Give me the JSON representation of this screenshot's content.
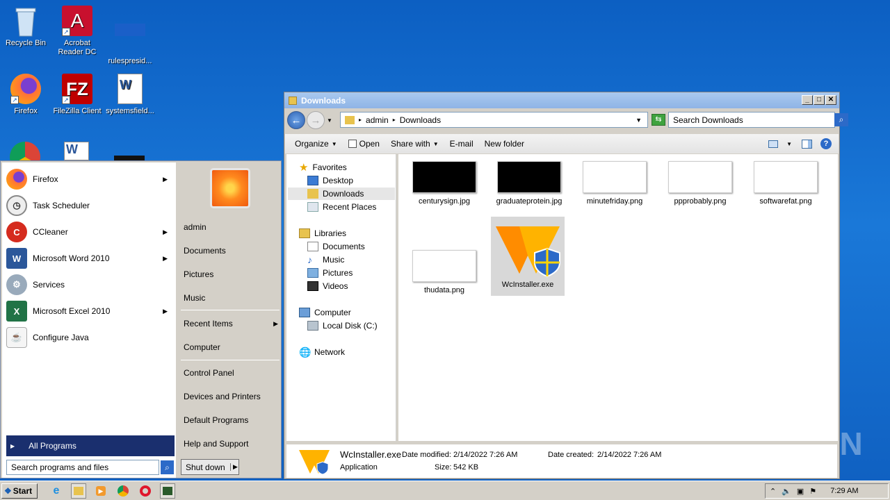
{
  "desktop": {
    "icons": [
      {
        "label": "Recycle Bin"
      },
      {
        "label": "Acrobat Reader DC"
      },
      {
        "label": "rulespresid..."
      },
      {
        "label": "Firefox"
      },
      {
        "label": "FileZilla Client"
      },
      {
        "label": "systemsfield..."
      }
    ],
    "watermark": "ANY RUN"
  },
  "explorer": {
    "title": "Downloads",
    "breadcrumb": [
      "admin",
      "Downloads"
    ],
    "search_placeholder": "Search Downloads",
    "toolbar": {
      "organize": "Organize",
      "open": "Open",
      "share_with": "Share with",
      "email": "E-mail",
      "new_folder": "New folder"
    },
    "nav": {
      "favorites": "Favorites",
      "desktop": "Desktop",
      "downloads": "Downloads",
      "recent_places": "Recent Places",
      "libraries": "Libraries",
      "documents": "Documents",
      "music": "Music",
      "pictures": "Pictures",
      "videos": "Videos",
      "computer": "Computer",
      "local_disk": "Local Disk (C:)",
      "network": "Network"
    },
    "files": [
      {
        "name": "centurysign.jpg"
      },
      {
        "name": "graduateprotein.jpg"
      },
      {
        "name": "minutefriday.png"
      },
      {
        "name": "ppprobably.png"
      },
      {
        "name": "softwarefat.png"
      },
      {
        "name": "thudata.png"
      },
      {
        "name": "WcInstaller.exe"
      }
    ],
    "details": {
      "name": "WcInstaller.exe",
      "type": "Application",
      "modified_label": "Date modified:",
      "modified": "2/14/2022 7:26 AM",
      "created_label": "Date created:",
      "created": "2/14/2022 7:26 AM",
      "size_label": "Size:",
      "size": "542 KB"
    }
  },
  "startmenu": {
    "programs": [
      {
        "label": "Firefox"
      },
      {
        "label": "Task Scheduler"
      },
      {
        "label": "CCleaner"
      },
      {
        "label": "Microsoft Word 2010"
      },
      {
        "label": "Services"
      },
      {
        "label": "Microsoft Excel 2010"
      },
      {
        "label": "Configure Java"
      }
    ],
    "all_programs": "All Programs",
    "search_placeholder": "Search programs and files",
    "right": {
      "admin": "admin",
      "documents": "Documents",
      "pictures": "Pictures",
      "music": "Music",
      "recent_items": "Recent Items",
      "computer": "Computer",
      "control_panel": "Control Panel",
      "devices_printers": "Devices and Printers",
      "default_programs": "Default Programs",
      "help_support": "Help and Support"
    },
    "shutdown": "Shut down"
  },
  "taskbar": {
    "start": "Start",
    "time": "7:29 AM"
  }
}
